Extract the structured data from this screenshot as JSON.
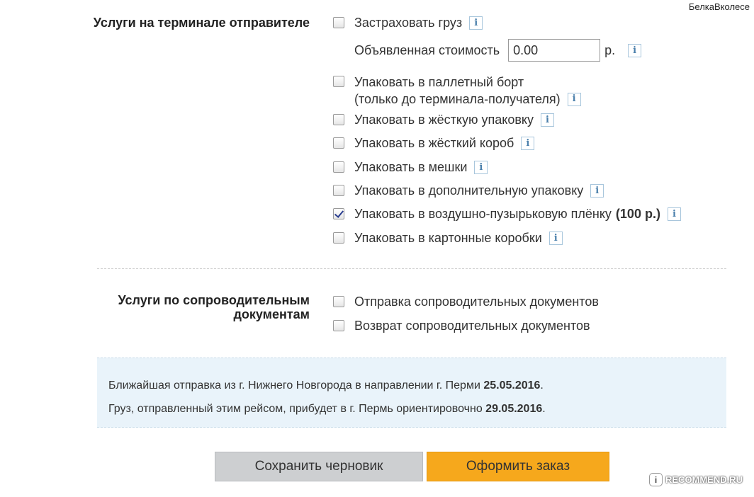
{
  "watermark": {
    "text": "БелкаВколесе"
  },
  "sender_services": {
    "title": "Услуги на терминале отправителе",
    "insure": {
      "label": "Застраховать груз",
      "checked": false
    },
    "declared_value": {
      "label": "Объявленная стоимость",
      "value": "0.00",
      "unit": "р."
    },
    "items": [
      {
        "label_line1": "Упаковать в паллетный борт",
        "label_line2": "(только до терминала-получателя)",
        "checked": false
      },
      {
        "label": "Упаковать в жёсткую упаковку",
        "checked": false
      },
      {
        "label": "Упаковать в жёсткий короб",
        "checked": false
      },
      {
        "label": "Упаковать в мешки",
        "checked": false
      },
      {
        "label": "Упаковать в дополнительную упаковку",
        "checked": false
      },
      {
        "label": "Упаковать в воздушно-пузырьковую плёнку",
        "price": "(100 р.)",
        "checked": true
      },
      {
        "label": "Упаковать в картонные коробки",
        "checked": false
      }
    ]
  },
  "docs_services": {
    "title": "Услуги по сопроводительным документам",
    "items": [
      {
        "label": "Отправка сопроводительных документов",
        "checked": false
      },
      {
        "label": "Возврат сопроводительных документов",
        "checked": false
      }
    ]
  },
  "notice": {
    "line1_text": "Ближайшая отправка из г. Нижнего Новгорода в направлении г. Перми ",
    "line1_date": "25.05.2016",
    "line1_end": ".",
    "line2_text": "Груз, отправленный этим рейсом, прибудет в г. Пермь ориентировочно ",
    "line2_date": "29.05.2016",
    "line2_end": "."
  },
  "buttons": {
    "draft": "Сохранить черновик",
    "order": "Оформить заказ"
  },
  "badge": {
    "mark": "i",
    "text": "RECOMMEND.RU"
  },
  "info_glyph": "i",
  "colors": {
    "order_button": "#f6a81c",
    "draft_button": "#cdcfd1",
    "notice_bg": "#e9f3fa",
    "info_border": "#a8c6dc"
  }
}
